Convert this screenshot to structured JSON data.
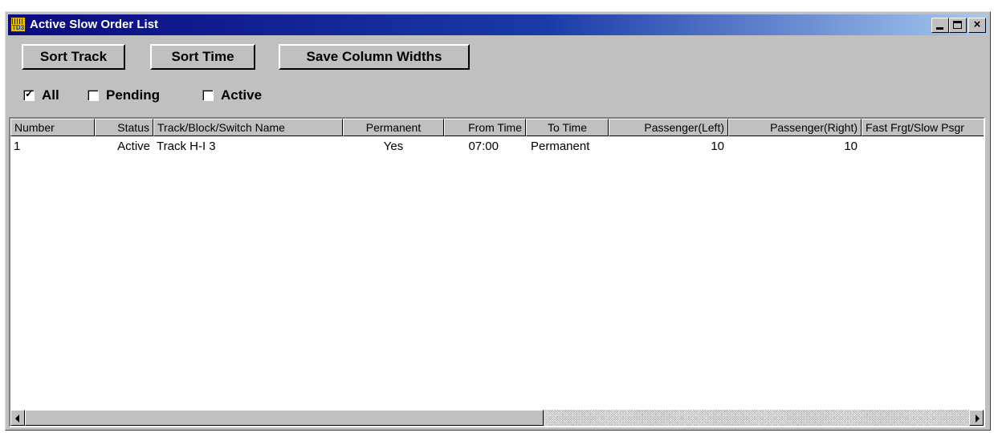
{
  "window": {
    "title": "Active Slow Order List",
    "icon_text": "TD3",
    "controls": {
      "minimize": "minimize-icon",
      "maximize": "maximize-icon",
      "close": "close-icon"
    }
  },
  "toolbar": {
    "sort_track_label": "Sort Track",
    "sort_time_label": "Sort Time",
    "save_widths_label": "Save Column Widths"
  },
  "filters": {
    "all": {
      "label": "All",
      "checked": true
    },
    "pending": {
      "label": "Pending",
      "checked": false
    },
    "active": {
      "label": "Active",
      "checked": false
    }
  },
  "table": {
    "columns": [
      "Number",
      "Status",
      "Track/Block/Switch Name",
      "Permanent",
      "From Time",
      "To Time",
      "Passenger(Left)",
      "Passenger(Right)",
      "Fast Frgt/Slow Psgr"
    ],
    "rows": [
      {
        "number": "1",
        "status": "Active",
        "name": "Track H-I 3",
        "permanent": "Yes",
        "from_time": "07:00",
        "to_time": "Permanent",
        "passenger_left": "10",
        "passenger_right": "10",
        "fast_frgt": ""
      }
    ]
  },
  "scrollbar": {
    "position": 0,
    "visible_fraction": 0.54
  },
  "colors": {
    "titlebar_start": "#0a0a80",
    "titlebar_end": "#a6caf0",
    "face": "#c0c0c0"
  }
}
